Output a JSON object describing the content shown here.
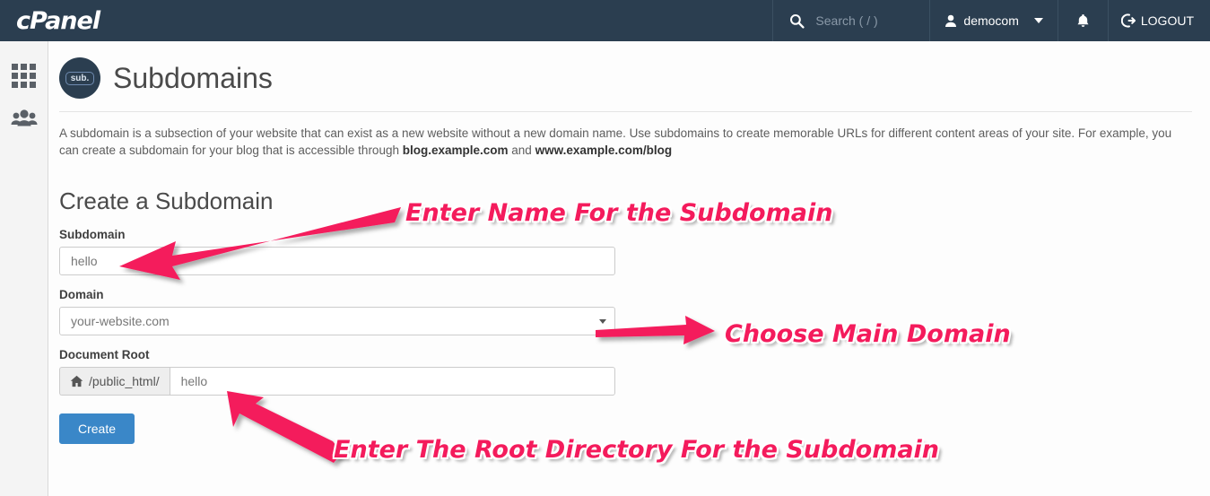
{
  "header": {
    "brand": "cPanel",
    "search": {
      "icon": "search-icon",
      "placeholder": "Search ( / )",
      "value": ""
    },
    "user": {
      "icon": "user-icon",
      "name": "democom",
      "caret": "chevron-down-icon"
    },
    "notifications": {
      "icon": "bell-icon"
    },
    "logout": {
      "icon": "logout-icon",
      "label": "LOGOUT"
    }
  },
  "sidebar": {
    "items": [
      {
        "name": "apps-grid-icon",
        "label": ""
      },
      {
        "name": "users-group-icon",
        "label": ""
      }
    ]
  },
  "page": {
    "icon_badge": "sub.",
    "title": "Subdomains",
    "description_part1": "A subdomain is a subsection of your website that can exist as a new website without a new domain name. Use subdomains to create memorable URLs for different content areas of your site. For example, you can create a subdomain for your blog that is accessible through ",
    "description_bold1": "blog.example.com",
    "description_part2": " and ",
    "description_bold2": "www.example.com/blog"
  },
  "form": {
    "section_title": "Create a Subdomain",
    "subdomain": {
      "label": "Subdomain",
      "value": "hello",
      "placeholder": ""
    },
    "domain": {
      "label": "Domain",
      "selected": "your-website.com",
      "caret": "chevron-down-icon"
    },
    "document_root": {
      "label": "Document Root",
      "addon_icon": "home-icon",
      "addon_text": "/public_html/",
      "value": "hello",
      "placeholder": ""
    },
    "create_button": "Create"
  },
  "annotations": [
    {
      "id": "anno1",
      "text": "Enter Name For the Subdomain",
      "color": "#F41B5C"
    },
    {
      "id": "anno2",
      "text": "Choose Main Domain",
      "color": "#F41B5C"
    },
    {
      "id": "anno3",
      "text": "Enter The Root Directory For the Subdomain",
      "color": "#F41B5C"
    }
  ],
  "colors": {
    "header_bg": "#2b3e50",
    "accent_button": "#3a87c8",
    "annotation_pink": "#F41B5C",
    "sidebar_bg": "#f4f4f4"
  }
}
